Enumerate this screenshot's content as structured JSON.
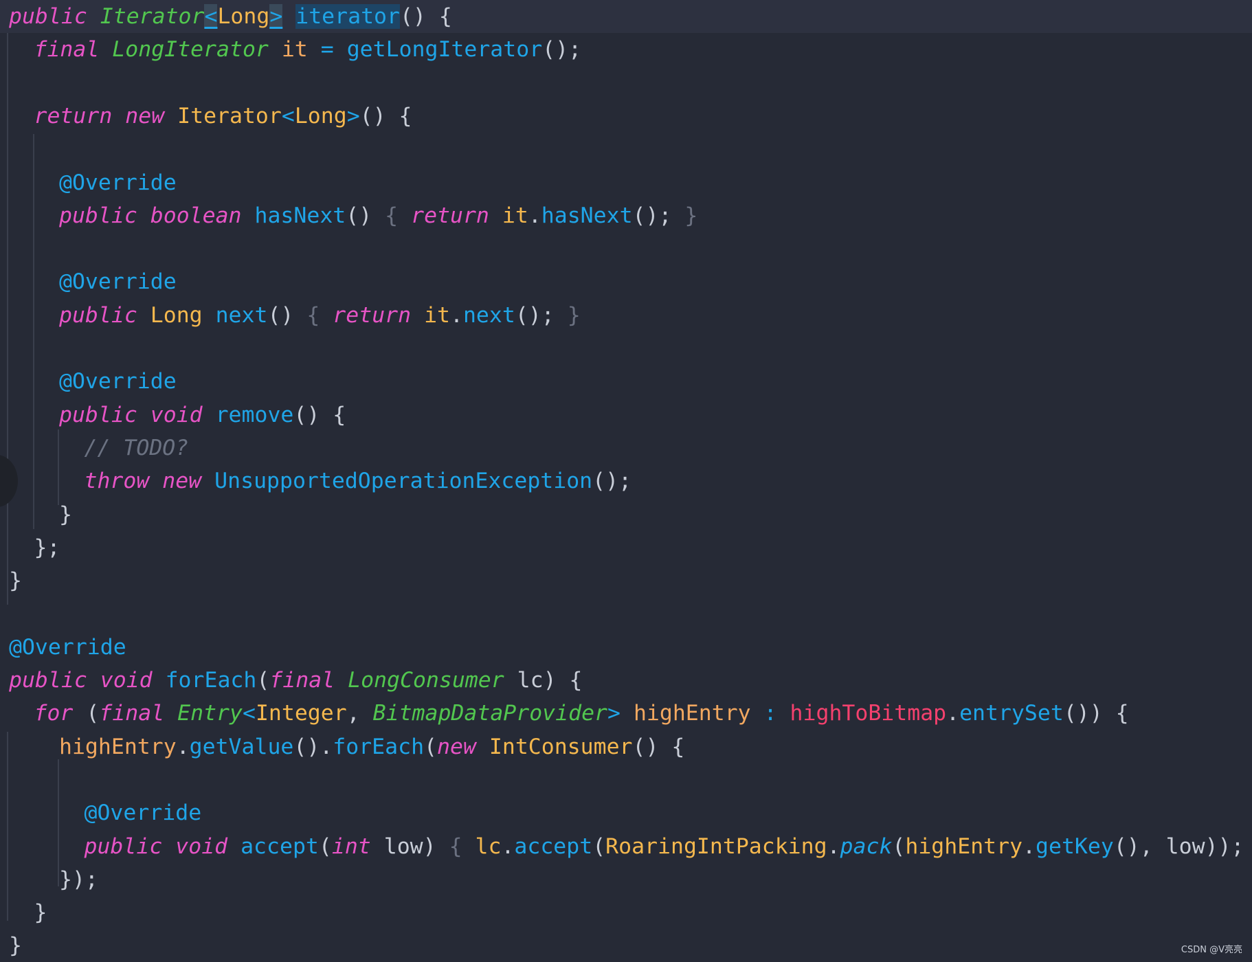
{
  "watermark": "CSDN @V亮亮",
  "colors": {
    "background": "#262a36",
    "keyword": "#e754c6",
    "type_italic": "#52c74f",
    "class": "#f5b84e",
    "function": "#1fa5e8",
    "variable": "#f2a860",
    "field": "#f5416e",
    "plain": "#c9ced8",
    "comment": "#6b7282"
  },
  "code_lines": [
    {
      "indent": 0,
      "current": true,
      "tokens": [
        {
          "t": "public",
          "c": "kw"
        },
        {
          "t": " ",
          "c": "pun"
        },
        {
          "t": "Iterator",
          "c": "type"
        },
        {
          "t": "<",
          "c": "op ul"
        },
        {
          "t": "Long",
          "c": "cls"
        },
        {
          "t": ">",
          "c": "op ul"
        },
        {
          "t": " ",
          "c": "pun"
        },
        {
          "t": "iterator",
          "c": "fn hl"
        },
        {
          "t": "() {",
          "c": "pun"
        }
      ]
    },
    {
      "indent": 1,
      "tokens": [
        {
          "t": "final",
          "c": "kw"
        },
        {
          "t": " ",
          "c": "pun"
        },
        {
          "t": "LongIterator",
          "c": "type"
        },
        {
          "t": " ",
          "c": "pun"
        },
        {
          "t": "it",
          "c": "var"
        },
        {
          "t": " ",
          "c": "pun"
        },
        {
          "t": "=",
          "c": "op"
        },
        {
          "t": " ",
          "c": "pun"
        },
        {
          "t": "getLongIterator",
          "c": "fn"
        },
        {
          "t": "();",
          "c": "pun"
        }
      ]
    },
    {
      "indent": 0,
      "tokens": []
    },
    {
      "indent": 1,
      "tokens": [
        {
          "t": "return",
          "c": "kw"
        },
        {
          "t": " ",
          "c": "pun"
        },
        {
          "t": "new",
          "c": "kw"
        },
        {
          "t": " ",
          "c": "pun"
        },
        {
          "t": "Iterator",
          "c": "cls"
        },
        {
          "t": "<",
          "c": "op"
        },
        {
          "t": "Long",
          "c": "cls"
        },
        {
          "t": ">",
          "c": "op"
        },
        {
          "t": "() {",
          "c": "pun"
        }
      ]
    },
    {
      "indent": 0,
      "tokens": []
    },
    {
      "indent": 2,
      "tokens": [
        {
          "t": "@Override",
          "c": "ann"
        }
      ]
    },
    {
      "indent": 2,
      "tokens": [
        {
          "t": "public",
          "c": "kw"
        },
        {
          "t": " ",
          "c": "pun"
        },
        {
          "t": "boolean",
          "c": "kw"
        },
        {
          "t": " ",
          "c": "pun"
        },
        {
          "t": "hasNext",
          "c": "fn"
        },
        {
          "t": "() ",
          "c": "pun"
        },
        {
          "t": "{",
          "c": "dim"
        },
        {
          "t": " ",
          "c": "pun"
        },
        {
          "t": "return",
          "c": "kw"
        },
        {
          "t": " ",
          "c": "pun"
        },
        {
          "t": "it",
          "c": "cls"
        },
        {
          "t": ".",
          "c": "pun"
        },
        {
          "t": "hasNext",
          "c": "fn"
        },
        {
          "t": "(); ",
          "c": "pun"
        },
        {
          "t": "}",
          "c": "dim"
        }
      ]
    },
    {
      "indent": 0,
      "tokens": []
    },
    {
      "indent": 2,
      "tokens": [
        {
          "t": "@Override",
          "c": "ann"
        }
      ]
    },
    {
      "indent": 2,
      "tokens": [
        {
          "t": "public",
          "c": "kw"
        },
        {
          "t": " ",
          "c": "pun"
        },
        {
          "t": "Long",
          "c": "cls"
        },
        {
          "t": " ",
          "c": "pun"
        },
        {
          "t": "next",
          "c": "fn"
        },
        {
          "t": "() ",
          "c": "pun"
        },
        {
          "t": "{",
          "c": "dim"
        },
        {
          "t": " ",
          "c": "pun"
        },
        {
          "t": "return",
          "c": "kw"
        },
        {
          "t": " ",
          "c": "pun"
        },
        {
          "t": "it",
          "c": "cls"
        },
        {
          "t": ".",
          "c": "pun"
        },
        {
          "t": "next",
          "c": "fn"
        },
        {
          "t": "(); ",
          "c": "pun"
        },
        {
          "t": "}",
          "c": "dim"
        }
      ]
    },
    {
      "indent": 0,
      "tokens": []
    },
    {
      "indent": 2,
      "tokens": [
        {
          "t": "@Override",
          "c": "ann"
        }
      ]
    },
    {
      "indent": 2,
      "tokens": [
        {
          "t": "public",
          "c": "kw"
        },
        {
          "t": " ",
          "c": "pun"
        },
        {
          "t": "void",
          "c": "kw"
        },
        {
          "t": " ",
          "c": "pun"
        },
        {
          "t": "remove",
          "c": "fn"
        },
        {
          "t": "() {",
          "c": "pun"
        }
      ]
    },
    {
      "indent": 3,
      "tokens": [
        {
          "t": "// TODO?",
          "c": "cmt"
        }
      ]
    },
    {
      "indent": 3,
      "tokens": [
        {
          "t": "throw",
          "c": "kw"
        },
        {
          "t": " ",
          "c": "pun"
        },
        {
          "t": "new",
          "c": "kw"
        },
        {
          "t": " ",
          "c": "pun"
        },
        {
          "t": "UnsupportedOperationException",
          "c": "fn"
        },
        {
          "t": "();",
          "c": "pun"
        }
      ]
    },
    {
      "indent": 2,
      "tokens": [
        {
          "t": "}",
          "c": "pun"
        }
      ]
    },
    {
      "indent": 1,
      "tokens": [
        {
          "t": "};",
          "c": "pun"
        }
      ]
    },
    {
      "indent": 0,
      "tokens": [
        {
          "t": "}",
          "c": "pun"
        }
      ]
    },
    {
      "indent": 0,
      "tokens": []
    },
    {
      "indent": 0,
      "tokens": [
        {
          "t": "@Override",
          "c": "ann"
        }
      ]
    },
    {
      "indent": 0,
      "tokens": [
        {
          "t": "public",
          "c": "kw"
        },
        {
          "t": " ",
          "c": "pun"
        },
        {
          "t": "void",
          "c": "kw"
        },
        {
          "t": " ",
          "c": "pun"
        },
        {
          "t": "forEach",
          "c": "fn"
        },
        {
          "t": "(",
          "c": "pun"
        },
        {
          "t": "final",
          "c": "kw"
        },
        {
          "t": " ",
          "c": "pun"
        },
        {
          "t": "LongConsumer",
          "c": "type"
        },
        {
          "t": " lc) {",
          "c": "pun"
        }
      ]
    },
    {
      "indent": 1,
      "tokens": [
        {
          "t": "for",
          "c": "kw"
        },
        {
          "t": " (",
          "c": "pun"
        },
        {
          "t": "final",
          "c": "kw"
        },
        {
          "t": " ",
          "c": "pun"
        },
        {
          "t": "Entry",
          "c": "type"
        },
        {
          "t": "<",
          "c": "op"
        },
        {
          "t": "Integer",
          "c": "cls"
        },
        {
          "t": ", ",
          "c": "pun"
        },
        {
          "t": "BitmapDataProvider",
          "c": "type"
        },
        {
          "t": ">",
          "c": "op"
        },
        {
          "t": " ",
          "c": "pun"
        },
        {
          "t": "highEntry",
          "c": "var"
        },
        {
          "t": " ",
          "c": "pun"
        },
        {
          "t": ":",
          "c": "op"
        },
        {
          "t": " ",
          "c": "pun"
        },
        {
          "t": "highToBitmap",
          "c": "fld"
        },
        {
          "t": ".",
          "c": "pun"
        },
        {
          "t": "entrySet",
          "c": "fn"
        },
        {
          "t": "()) {",
          "c": "pun"
        }
      ]
    },
    {
      "indent": 2,
      "tokens": [
        {
          "t": "highEntry",
          "c": "var"
        },
        {
          "t": ".",
          "c": "pun"
        },
        {
          "t": "getValue",
          "c": "fn"
        },
        {
          "t": "().",
          "c": "pun"
        },
        {
          "t": "forEach",
          "c": "fn"
        },
        {
          "t": "(",
          "c": "pun"
        },
        {
          "t": "new",
          "c": "kw"
        },
        {
          "t": " ",
          "c": "pun"
        },
        {
          "t": "IntConsumer",
          "c": "cls"
        },
        {
          "t": "() {",
          "c": "pun"
        }
      ]
    },
    {
      "indent": 0,
      "tokens": []
    },
    {
      "indent": 3,
      "tokens": [
        {
          "t": "@Override",
          "c": "ann"
        }
      ]
    },
    {
      "indent": 3,
      "tokens": [
        {
          "t": "public",
          "c": "kw"
        },
        {
          "t": " ",
          "c": "pun"
        },
        {
          "t": "void",
          "c": "kw"
        },
        {
          "t": " ",
          "c": "pun"
        },
        {
          "t": "accept",
          "c": "fn"
        },
        {
          "t": "(",
          "c": "pun"
        },
        {
          "t": "int",
          "c": "kw"
        },
        {
          "t": " low) ",
          "c": "pun"
        },
        {
          "t": "{",
          "c": "dim"
        },
        {
          "t": " ",
          "c": "pun"
        },
        {
          "t": "lc",
          "c": "cls"
        },
        {
          "t": ".",
          "c": "pun"
        },
        {
          "t": "accept",
          "c": "fn"
        },
        {
          "t": "(",
          "c": "pun"
        },
        {
          "t": "RoaringIntPacking",
          "c": "cls"
        },
        {
          "t": ".",
          "c": "pun"
        },
        {
          "t": "pack",
          "c": "sfn"
        },
        {
          "t": "(",
          "c": "pun"
        },
        {
          "t": "highEntry",
          "c": "cls"
        },
        {
          "t": ".",
          "c": "pun"
        },
        {
          "t": "getKey",
          "c": "fn"
        },
        {
          "t": "(), low)); ",
          "c": "pun"
        },
        {
          "t": "}",
          "c": "dim"
        }
      ]
    },
    {
      "indent": 2,
      "tokens": [
        {
          "t": "});",
          "c": "pun"
        }
      ]
    },
    {
      "indent": 1,
      "tokens": [
        {
          "t": "}",
          "c": "pun"
        }
      ]
    },
    {
      "indent": 0,
      "tokens": [
        {
          "t": "}",
          "c": "pun"
        }
      ]
    }
  ]
}
